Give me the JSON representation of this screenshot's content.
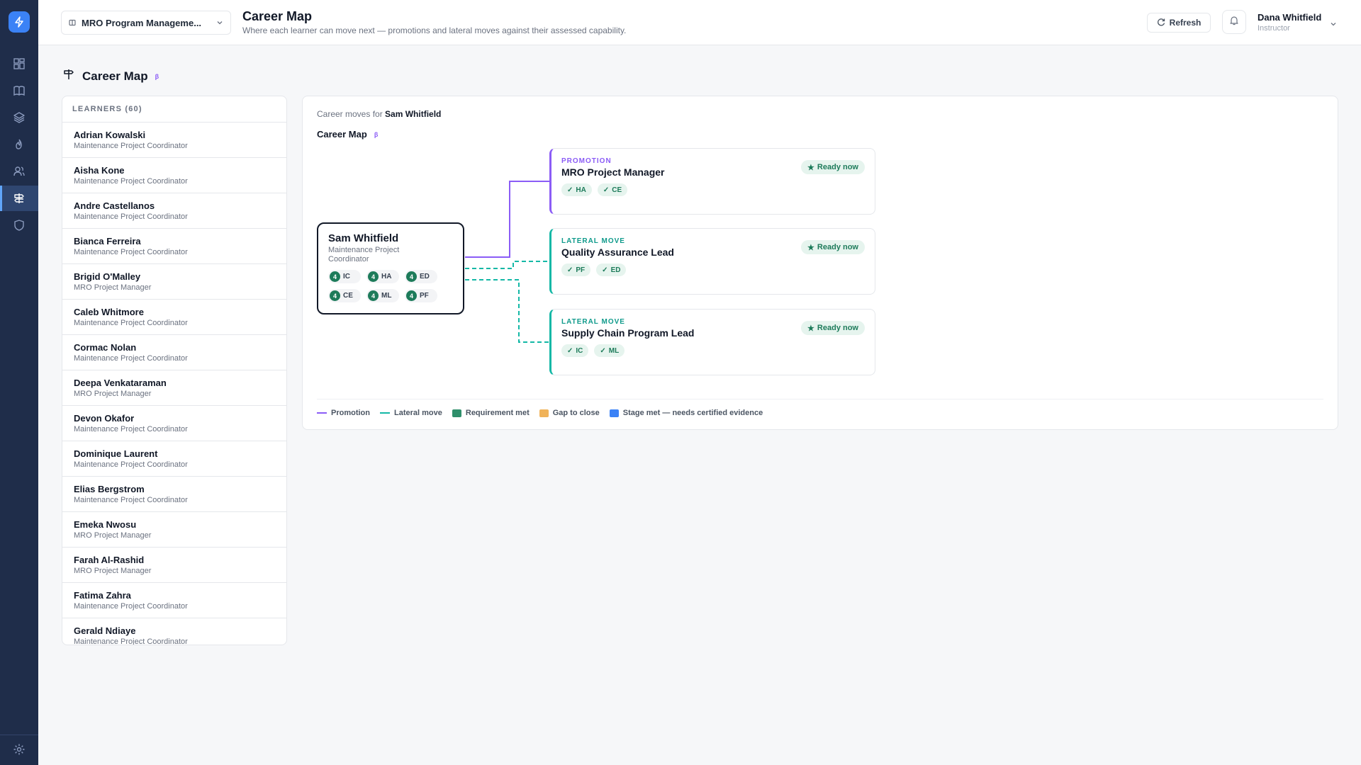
{
  "header": {
    "program_select": "MRO Program Manageme...",
    "title": "Career Map",
    "subtitle": "Where each learner can move next — promotions and lateral moves against their assessed capability.",
    "refresh_label": "Refresh",
    "user_name": "Dana Whitfield",
    "user_role": "Instructor"
  },
  "sidebar": {
    "items": [
      "dashboard",
      "courses",
      "layers",
      "streak",
      "people",
      "career-map",
      "security"
    ],
    "active": "career-map"
  },
  "page": {
    "title": "Career Map",
    "beta": "β"
  },
  "learners": {
    "heading": "LEARNERS (60)",
    "items": [
      {
        "name": "Adrian Kowalski",
        "role": "Maintenance Project Coordinator"
      },
      {
        "name": "Aisha Kone",
        "role": "Maintenance Project Coordinator"
      },
      {
        "name": "Andre Castellanos",
        "role": "Maintenance Project Coordinator"
      },
      {
        "name": "Bianca Ferreira",
        "role": "Maintenance Project Coordinator"
      },
      {
        "name": "Brigid O'Malley",
        "role": "MRO Project Manager"
      },
      {
        "name": "Caleb Whitmore",
        "role": "Maintenance Project Coordinator"
      },
      {
        "name": "Cormac Nolan",
        "role": "Maintenance Project Coordinator"
      },
      {
        "name": "Deepa Venkataraman",
        "role": "MRO Project Manager"
      },
      {
        "name": "Devon Okafor",
        "role": "Maintenance Project Coordinator"
      },
      {
        "name": "Dominique Laurent",
        "role": "Maintenance Project Coordinator"
      },
      {
        "name": "Elias Bergstrom",
        "role": "Maintenance Project Coordinator"
      },
      {
        "name": "Emeka Nwosu",
        "role": "MRO Project Manager"
      },
      {
        "name": "Farah Al-Rashid",
        "role": "MRO Project Manager"
      },
      {
        "name": "Fatima Zahra",
        "role": "Maintenance Project Coordinator"
      },
      {
        "name": "Gerald Ndiaye",
        "role": "Maintenance Project Coordinator"
      }
    ]
  },
  "map": {
    "moves_prefix": "Career moves for",
    "learner": "Sam Whitfield",
    "title": "Career Map",
    "beta": "β",
    "source": {
      "name": "Sam Whitfield",
      "role": "Maintenance Project Coordinator",
      "capabilities": [
        {
          "level": "4",
          "code": "IC"
        },
        {
          "level": "4",
          "code": "HA"
        },
        {
          "level": "4",
          "code": "ED"
        },
        {
          "level": "4",
          "code": "CE"
        },
        {
          "level": "4",
          "code": "ML"
        },
        {
          "level": "4",
          "code": "PF"
        }
      ]
    },
    "targets": [
      {
        "kind": "PROMOTION",
        "title": "MRO Project Manager",
        "status": "Ready now",
        "requirements": [
          "HA",
          "CE"
        ]
      },
      {
        "kind": "LATERAL MOVE",
        "title": "Quality Assurance Lead",
        "status": "Ready now",
        "requirements": [
          "PF",
          "ED"
        ]
      },
      {
        "kind": "LATERAL MOVE",
        "title": "Supply Chain Program Lead",
        "status": "Ready now",
        "requirements": [
          "IC",
          "ML"
        ]
      }
    ],
    "legend": [
      {
        "label": "Promotion",
        "color": "#8b5cf6"
      },
      {
        "label": "Lateral move",
        "color": "#14b8a6"
      },
      {
        "label": "Requirement met",
        "color": "#2f8f6b"
      },
      {
        "label": "Gap to close",
        "color": "#f0b35a"
      },
      {
        "label": "Stage met — needs certified evidence",
        "color": "#3b82f6"
      }
    ]
  },
  "colors": {
    "sidebar": "#1f2d4a",
    "accent": "#3b82f6",
    "promotion": "#8b5cf6",
    "lateral": "#14b8a6",
    "met": "#1d7b5a"
  }
}
